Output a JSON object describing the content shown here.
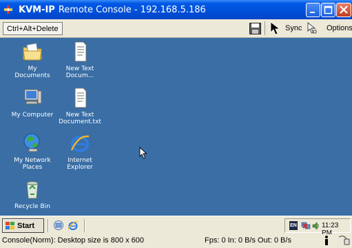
{
  "window": {
    "brand": "KVM-IP",
    "title": "Remote Console - 192.168.5.186"
  },
  "toolbar": {
    "cad_label": "Ctrl+Alt+Delete",
    "sync_label": "Sync",
    "options_label": "Options"
  },
  "desktop": {
    "icons": [
      {
        "label": "My Documents",
        "icon": "folder-documents-icon"
      },
      {
        "label": "New Text Docum...",
        "icon": "text-file-icon"
      },
      {
        "label": "My Computer",
        "icon": "computer-icon"
      },
      {
        "label": "New Text Document.txt",
        "icon": "text-file-icon"
      },
      {
        "label": "My Network Places",
        "icon": "network-places-icon"
      },
      {
        "label": "Internet Explorer",
        "icon": "internet-explorer-icon"
      },
      {
        "label": "Recycle Bin",
        "icon": "recycle-bin-icon"
      }
    ]
  },
  "taskbar": {
    "start_label": "Start",
    "lang": "EN",
    "clock": "11:23 PM"
  },
  "status": {
    "console": "Console(Norm): Desktop size is 800 x 600",
    "fps": "Fps: 0 In: 0 B/s Out: 0 B/s"
  },
  "colors": {
    "desktop": "#3a6ea5",
    "titlebar": "#0054e3",
    "chrome": "#ece9d8"
  }
}
